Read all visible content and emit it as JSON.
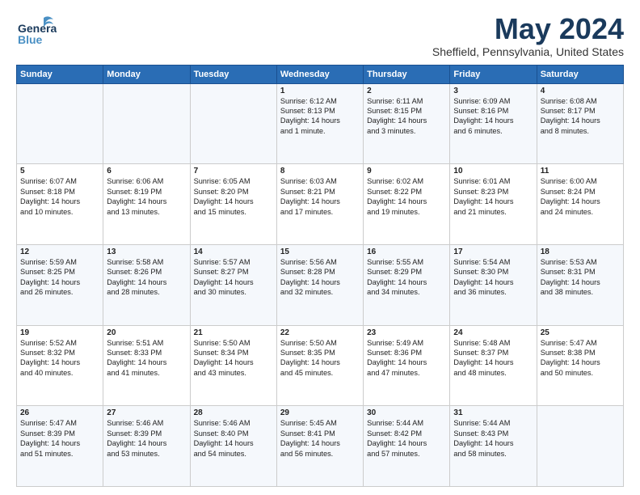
{
  "header": {
    "logo_general": "General",
    "logo_blue": "Blue",
    "title": "May 2024",
    "subtitle": "Sheffield, Pennsylvania, United States"
  },
  "days_of_week": [
    "Sunday",
    "Monday",
    "Tuesday",
    "Wednesday",
    "Thursday",
    "Friday",
    "Saturday"
  ],
  "weeks": [
    [
      {
        "day": "",
        "lines": []
      },
      {
        "day": "",
        "lines": []
      },
      {
        "day": "",
        "lines": []
      },
      {
        "day": "1",
        "lines": [
          "Sunrise: 6:12 AM",
          "Sunset: 8:13 PM",
          "Daylight: 14 hours",
          "and 1 minute."
        ]
      },
      {
        "day": "2",
        "lines": [
          "Sunrise: 6:11 AM",
          "Sunset: 8:15 PM",
          "Daylight: 14 hours",
          "and 3 minutes."
        ]
      },
      {
        "day": "3",
        "lines": [
          "Sunrise: 6:09 AM",
          "Sunset: 8:16 PM",
          "Daylight: 14 hours",
          "and 6 minutes."
        ]
      },
      {
        "day": "4",
        "lines": [
          "Sunrise: 6:08 AM",
          "Sunset: 8:17 PM",
          "Daylight: 14 hours",
          "and 8 minutes."
        ]
      }
    ],
    [
      {
        "day": "5",
        "lines": [
          "Sunrise: 6:07 AM",
          "Sunset: 8:18 PM",
          "Daylight: 14 hours",
          "and 10 minutes."
        ]
      },
      {
        "day": "6",
        "lines": [
          "Sunrise: 6:06 AM",
          "Sunset: 8:19 PM",
          "Daylight: 14 hours",
          "and 13 minutes."
        ]
      },
      {
        "day": "7",
        "lines": [
          "Sunrise: 6:05 AM",
          "Sunset: 8:20 PM",
          "Daylight: 14 hours",
          "and 15 minutes."
        ]
      },
      {
        "day": "8",
        "lines": [
          "Sunrise: 6:03 AM",
          "Sunset: 8:21 PM",
          "Daylight: 14 hours",
          "and 17 minutes."
        ]
      },
      {
        "day": "9",
        "lines": [
          "Sunrise: 6:02 AM",
          "Sunset: 8:22 PM",
          "Daylight: 14 hours",
          "and 19 minutes."
        ]
      },
      {
        "day": "10",
        "lines": [
          "Sunrise: 6:01 AM",
          "Sunset: 8:23 PM",
          "Daylight: 14 hours",
          "and 21 minutes."
        ]
      },
      {
        "day": "11",
        "lines": [
          "Sunrise: 6:00 AM",
          "Sunset: 8:24 PM",
          "Daylight: 14 hours",
          "and 24 minutes."
        ]
      }
    ],
    [
      {
        "day": "12",
        "lines": [
          "Sunrise: 5:59 AM",
          "Sunset: 8:25 PM",
          "Daylight: 14 hours",
          "and 26 minutes."
        ]
      },
      {
        "day": "13",
        "lines": [
          "Sunrise: 5:58 AM",
          "Sunset: 8:26 PM",
          "Daylight: 14 hours",
          "and 28 minutes."
        ]
      },
      {
        "day": "14",
        "lines": [
          "Sunrise: 5:57 AM",
          "Sunset: 8:27 PM",
          "Daylight: 14 hours",
          "and 30 minutes."
        ]
      },
      {
        "day": "15",
        "lines": [
          "Sunrise: 5:56 AM",
          "Sunset: 8:28 PM",
          "Daylight: 14 hours",
          "and 32 minutes."
        ]
      },
      {
        "day": "16",
        "lines": [
          "Sunrise: 5:55 AM",
          "Sunset: 8:29 PM",
          "Daylight: 14 hours",
          "and 34 minutes."
        ]
      },
      {
        "day": "17",
        "lines": [
          "Sunrise: 5:54 AM",
          "Sunset: 8:30 PM",
          "Daylight: 14 hours",
          "and 36 minutes."
        ]
      },
      {
        "day": "18",
        "lines": [
          "Sunrise: 5:53 AM",
          "Sunset: 8:31 PM",
          "Daylight: 14 hours",
          "and 38 minutes."
        ]
      }
    ],
    [
      {
        "day": "19",
        "lines": [
          "Sunrise: 5:52 AM",
          "Sunset: 8:32 PM",
          "Daylight: 14 hours",
          "and 40 minutes."
        ]
      },
      {
        "day": "20",
        "lines": [
          "Sunrise: 5:51 AM",
          "Sunset: 8:33 PM",
          "Daylight: 14 hours",
          "and 41 minutes."
        ]
      },
      {
        "day": "21",
        "lines": [
          "Sunrise: 5:50 AM",
          "Sunset: 8:34 PM",
          "Daylight: 14 hours",
          "and 43 minutes."
        ]
      },
      {
        "day": "22",
        "lines": [
          "Sunrise: 5:50 AM",
          "Sunset: 8:35 PM",
          "Daylight: 14 hours",
          "and 45 minutes."
        ]
      },
      {
        "day": "23",
        "lines": [
          "Sunrise: 5:49 AM",
          "Sunset: 8:36 PM",
          "Daylight: 14 hours",
          "and 47 minutes."
        ]
      },
      {
        "day": "24",
        "lines": [
          "Sunrise: 5:48 AM",
          "Sunset: 8:37 PM",
          "Daylight: 14 hours",
          "and 48 minutes."
        ]
      },
      {
        "day": "25",
        "lines": [
          "Sunrise: 5:47 AM",
          "Sunset: 8:38 PM",
          "Daylight: 14 hours",
          "and 50 minutes."
        ]
      }
    ],
    [
      {
        "day": "26",
        "lines": [
          "Sunrise: 5:47 AM",
          "Sunset: 8:39 PM",
          "Daylight: 14 hours",
          "and 51 minutes."
        ]
      },
      {
        "day": "27",
        "lines": [
          "Sunrise: 5:46 AM",
          "Sunset: 8:39 PM",
          "Daylight: 14 hours",
          "and 53 minutes."
        ]
      },
      {
        "day": "28",
        "lines": [
          "Sunrise: 5:46 AM",
          "Sunset: 8:40 PM",
          "Daylight: 14 hours",
          "and 54 minutes."
        ]
      },
      {
        "day": "29",
        "lines": [
          "Sunrise: 5:45 AM",
          "Sunset: 8:41 PM",
          "Daylight: 14 hours",
          "and 56 minutes."
        ]
      },
      {
        "day": "30",
        "lines": [
          "Sunrise: 5:44 AM",
          "Sunset: 8:42 PM",
          "Daylight: 14 hours",
          "and 57 minutes."
        ]
      },
      {
        "day": "31",
        "lines": [
          "Sunrise: 5:44 AM",
          "Sunset: 8:43 PM",
          "Daylight: 14 hours",
          "and 58 minutes."
        ]
      },
      {
        "day": "",
        "lines": []
      }
    ]
  ]
}
